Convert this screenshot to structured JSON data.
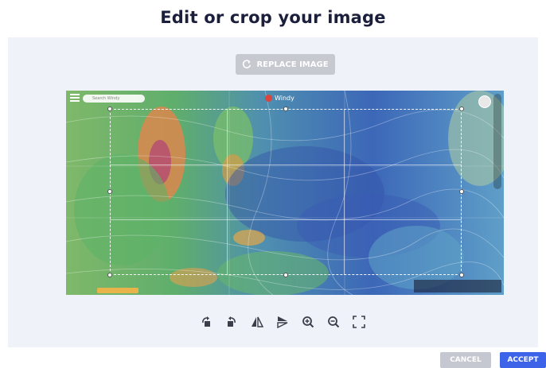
{
  "dialog": {
    "title": "Edit or crop your image",
    "replace_label": "REPLACE IMAGE"
  },
  "image": {
    "app_name": "Windy",
    "search_placeholder": "Search Windy"
  },
  "toolbar": {
    "tools": [
      {
        "name": "rotate-left-icon"
      },
      {
        "name": "rotate-right-icon"
      },
      {
        "name": "flip-horizontal-icon"
      },
      {
        "name": "flip-vertical-icon"
      },
      {
        "name": "zoom-in-icon"
      },
      {
        "name": "zoom-out-icon"
      },
      {
        "name": "fit-screen-icon"
      }
    ]
  },
  "footer": {
    "cancel_label": "CANCEL",
    "accept_label": "ACCEPT"
  },
  "colors": {
    "accent": "#3d63e8",
    "title": "#1b1f3b",
    "panel": "#f0f2f9"
  }
}
